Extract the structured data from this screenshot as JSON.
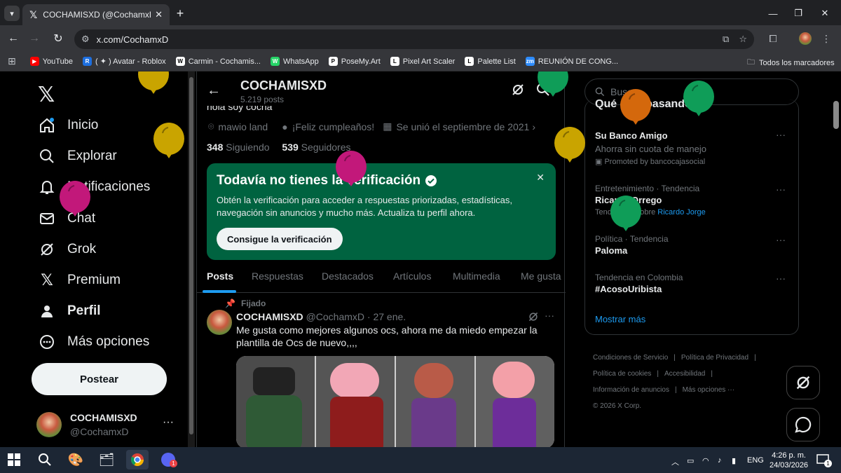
{
  "browser": {
    "tab_title": "COCHAMISXD (@CochamxD) /",
    "url": "x.com/CochamxD",
    "bookmarks": [
      {
        "label": "YouTube",
        "color": "#ff0000",
        "glyph": "▶"
      },
      {
        "label": "( ✦ ) Avatar - Roblox",
        "color": "#1d6fe0",
        "glyph": "R"
      },
      {
        "label": "Carmin - Cochamis...",
        "color": "#ffffff",
        "glyph": "W"
      },
      {
        "label": "WhatsApp",
        "color": "#25d366",
        "glyph": "W"
      },
      {
        "label": "PoseMy.Art",
        "color": "#ffffff",
        "glyph": "P"
      },
      {
        "label": "Pixel Art Scaler",
        "color": "#ffffff",
        "glyph": "L"
      },
      {
        "label": "Palette List",
        "color": "#ffffff",
        "glyph": "L"
      },
      {
        "label": "REUNIÓN DE CONG...",
        "color": "#2d8cff",
        "glyph": "zm"
      }
    ],
    "all_bookmarks": "Todos los marcadores"
  },
  "nav": {
    "items": [
      {
        "label": "Inicio",
        "icon": "home-icon"
      },
      {
        "label": "Explorar",
        "icon": "search-icon"
      },
      {
        "label": "Notificaciones",
        "icon": "bell-icon"
      },
      {
        "label": "Chat",
        "icon": "mail-icon"
      },
      {
        "label": "Grok",
        "icon": "grok-icon"
      },
      {
        "label": "Premium",
        "icon": "x-logo-icon"
      },
      {
        "label": "Perfil",
        "icon": "person-icon"
      },
      {
        "label": "Más opciones",
        "icon": "more-circle-icon"
      }
    ],
    "post_button": "Postear",
    "account_name": "COCHAMISXD",
    "account_handle": "@CochamxD"
  },
  "profile": {
    "name": "COCHAMISXD",
    "post_count": "5.219 posts",
    "bio": "hola soy cocha",
    "location": "mawio land",
    "birthday": "¡Feliz cumpleaños!",
    "joined": "Se unió el septiembre de 2021",
    "following_count": "348",
    "following_label": "Siguiendo",
    "followers_count": "539",
    "followers_label": "Seguidores"
  },
  "verification": {
    "title": "Todavía no tienes la verificación",
    "body": "Obtén la verificación para acceder a respuestas priorizadas, estadísticas, navegación sin anuncios y mucho más. Actualiza tu perfil ahora.",
    "button": "Consigue la verificación"
  },
  "profile_tabs": [
    "Posts",
    "Respuestas",
    "Destacados",
    "Artículos",
    "Multimedia",
    "Me gusta"
  ],
  "post": {
    "pinned": "Fijado",
    "author": "COCHAMISXD",
    "handle": "@CochamxD",
    "date": "· 27 ene.",
    "text": "Me gusta como mejores algunos ocs, ahora me da miedo empezar la plantilla de Ocs de nuevo,,,,"
  },
  "sidebar": {
    "search_placeholder": "Buscar",
    "section_title": "Qué está pasando",
    "trends": [
      {
        "meta": "",
        "name": "Su Banco Amigo",
        "sub": "Ahorra sin cuota de manejo",
        "promo": "Promoted by bancocajasocial"
      },
      {
        "meta": "Entretenimiento · Tendencia",
        "name": "Ricardo Orrego",
        "sub_prefix": "Tendencias sobre",
        "sub_link": "Ricardo Jorge"
      },
      {
        "meta": "Política · Tendencia",
        "name": "Paloma"
      },
      {
        "meta": "Tendencia en Colombia",
        "name": "#AcosoUribista"
      }
    ],
    "show_more": "Mostrar más",
    "footer": {
      "l1": "Condiciones de Servicio",
      "l2": "Política de Privacidad",
      "l3": "Política de cookies",
      "l4": "Accesibilidad",
      "l5": "Información de anuncios",
      "l6": "Más opciones ···",
      "copyright": "© 2026 X Corp."
    }
  },
  "taskbar": {
    "lang": "ENG",
    "time": "4:26 p. m.",
    "date": "24/03/2026",
    "notif_count": "1"
  },
  "colors": {
    "accent_blue": "#1d9bf0",
    "verify_green": "#006340"
  }
}
